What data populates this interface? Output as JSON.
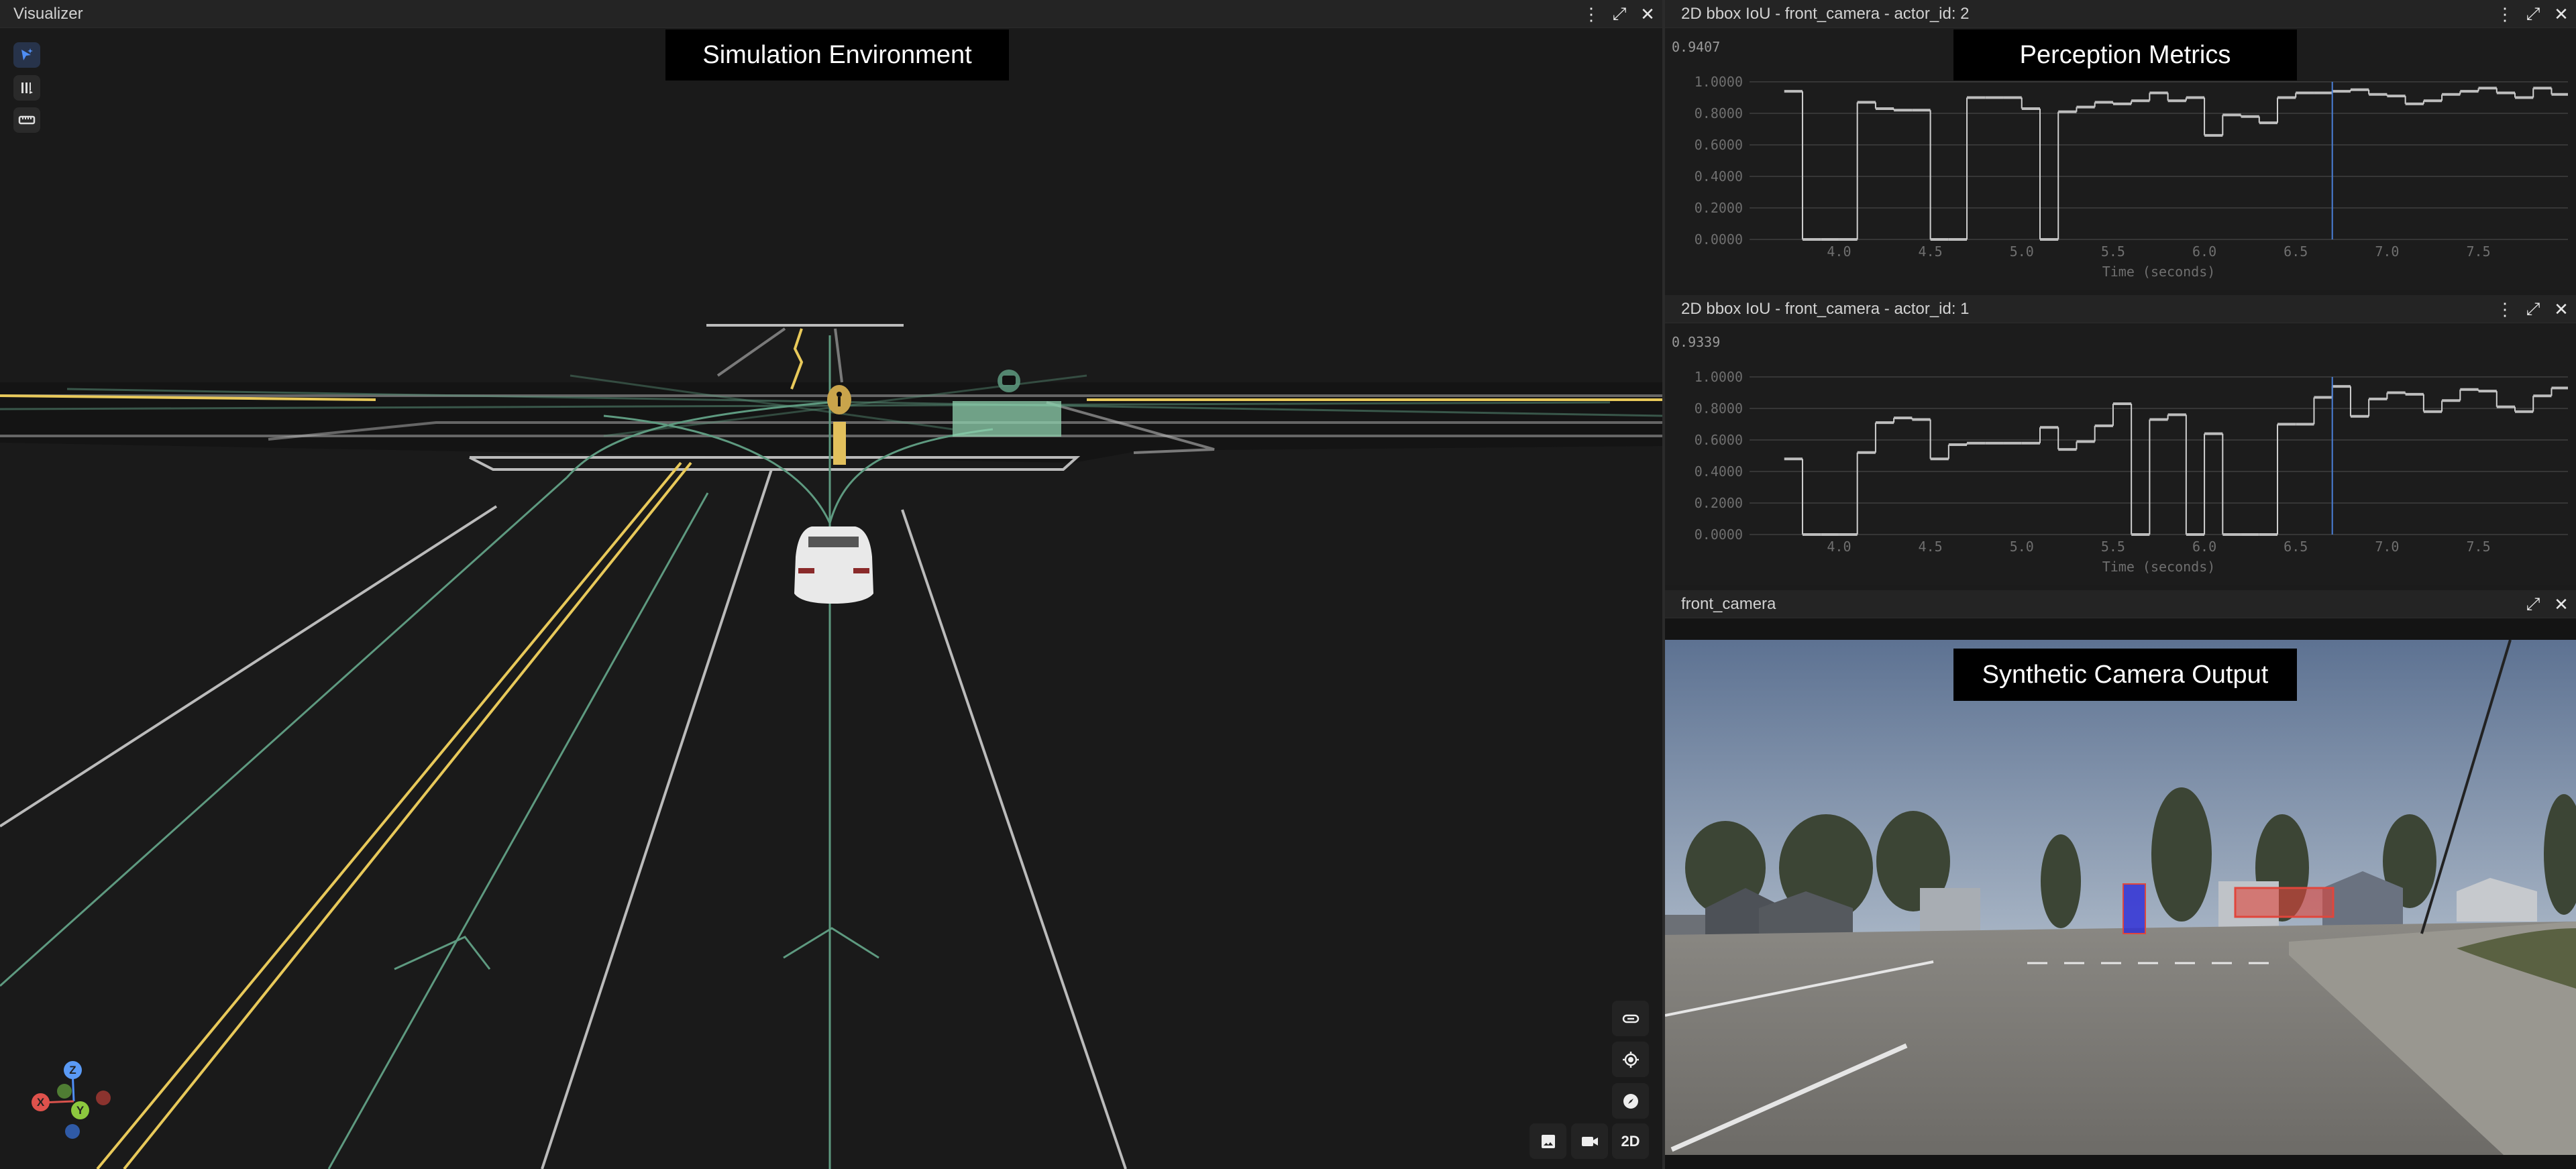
{
  "visualizer": {
    "title": "Visualizer",
    "overlay_label": "Simulation Environment",
    "toolbar": [
      "select-icon",
      "ruler-layers-icon",
      "measure-icon"
    ],
    "view_buttons": {
      "mode_2d": "2D"
    },
    "gizmo": {
      "x": "X",
      "y": "Y",
      "z": "Z"
    }
  },
  "perception_label": "Perception Metrics",
  "camera": {
    "title": "front_camera",
    "overlay_label": "Synthetic Camera Output",
    "bbox_colors": {
      "pedestrian": "#2a2ad8",
      "vehicle": "#e0463c"
    }
  },
  "colors": {
    "accent": "#4a7fd6",
    "lane_yellow": "#e8c95a",
    "lane_green": "#5e9a80"
  },
  "chart_data": [
    {
      "type": "line",
      "title": "2D bbox IoU - front_camera - actor_id: 2",
      "current_value": "0.9407",
      "xlabel": "Time (seconds)",
      "ylabel": "",
      "xlim": [
        3.51,
        7.99
      ],
      "ylim": [
        0,
        1
      ],
      "yticks": [
        "0.0000",
        "0.2000",
        "0.4000",
        "0.6000",
        "0.8000",
        "1.0000"
      ],
      "xticks": [
        "4.0",
        "4.5",
        "5.0",
        "5.5",
        "6.0",
        "6.5",
        "7.0",
        "7.5"
      ],
      "cursor_time": 6.7,
      "grid": true,
      "step": 0.1,
      "x_start": 3.7,
      "values": [
        0.94,
        0,
        0,
        0,
        0.87,
        0.83,
        0.82,
        0.82,
        0,
        0,
        0.9,
        0.9,
        0.9,
        0.83,
        0,
        0.81,
        0.84,
        0.87,
        0.86,
        0.88,
        0.93,
        0.88,
        0.9,
        0.66,
        0.79,
        0.78,
        0.74,
        0.9,
        0.93,
        0.93,
        0.94,
        0.95,
        0.92,
        0.91,
        0.86,
        0.88,
        0.92,
        0.94,
        0.96,
        0.93,
        0.9,
        0.96,
        0.92
      ]
    },
    {
      "type": "line",
      "title": "2D bbox IoU - front_camera - actor_id: 1",
      "current_value": "0.9339",
      "xlabel": "Time (seconds)",
      "ylabel": "",
      "xlim": [
        3.51,
        7.99
      ],
      "ylim": [
        0,
        1
      ],
      "yticks": [
        "0.0000",
        "0.2000",
        "0.4000",
        "0.6000",
        "0.8000",
        "1.0000"
      ],
      "xticks": [
        "4.0",
        "4.5",
        "5.0",
        "5.5",
        "6.0",
        "6.5",
        "7.0",
        "7.5"
      ],
      "cursor_time": 6.7,
      "grid": true,
      "step": 0.1,
      "x_start": 3.7,
      "values": [
        0.48,
        0,
        0,
        0,
        0.52,
        0.71,
        0.74,
        0.73,
        0.48,
        0.57,
        0.58,
        0.58,
        0.58,
        0.58,
        0.68,
        0.54,
        0.59,
        0.69,
        0.83,
        0,
        0.73,
        0.76,
        0,
        0.64,
        0,
        0,
        0,
        0.7,
        0.7,
        0.87,
        0.94,
        0.75,
        0.86,
        0.9,
        0.89,
        0.78,
        0.85,
        0.92,
        0.91,
        0.81,
        0.78,
        0.88,
        0.93
      ]
    }
  ]
}
